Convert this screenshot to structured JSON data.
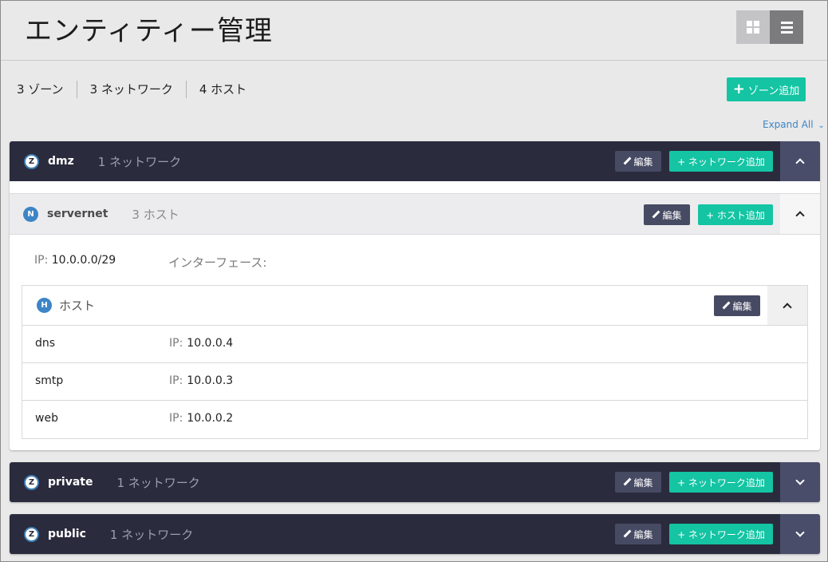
{
  "page": {
    "title": "エンティティー管理"
  },
  "summary": {
    "zones": "3 ゾーン",
    "networks": "3 ネットワーク",
    "hosts": "4 ホスト"
  },
  "actions": {
    "add_zone": "ゾーン追加",
    "add_zone_plus": "+",
    "expand_all": "Expand All"
  },
  "common": {
    "edit": "編集",
    "add_network": "+ ネットワーク追加",
    "add_host": "+ ホスト追加",
    "ip_label": "IP:"
  },
  "zones": [
    {
      "badge": "Z",
      "name": "dmz",
      "count": "1 ネットワーク",
      "expanded": true
    },
    {
      "badge": "Z",
      "name": "private",
      "count": "1 ネットワーク",
      "expanded": false
    },
    {
      "badge": "Z",
      "name": "public",
      "count": "1 ネットワーク",
      "expanded": false
    }
  ],
  "network": {
    "badge": "N",
    "name": "servernet",
    "count": "3 ホスト",
    "ip": "10.0.0.0/29",
    "interface_label": "インターフェース:"
  },
  "hosts_section": {
    "badge": "H",
    "title": "ホスト",
    "rows": [
      {
        "name": "dns",
        "ip": "10.0.0.4"
      },
      {
        "name": "smtp",
        "ip": "10.0.0.3"
      },
      {
        "name": "web",
        "ip": "10.0.0.2"
      }
    ]
  },
  "colors": {
    "dark_header": "#2a2b3d",
    "teal": "#14c4a3",
    "edit": "#474a63",
    "badge_blue": "#3d85c6"
  }
}
